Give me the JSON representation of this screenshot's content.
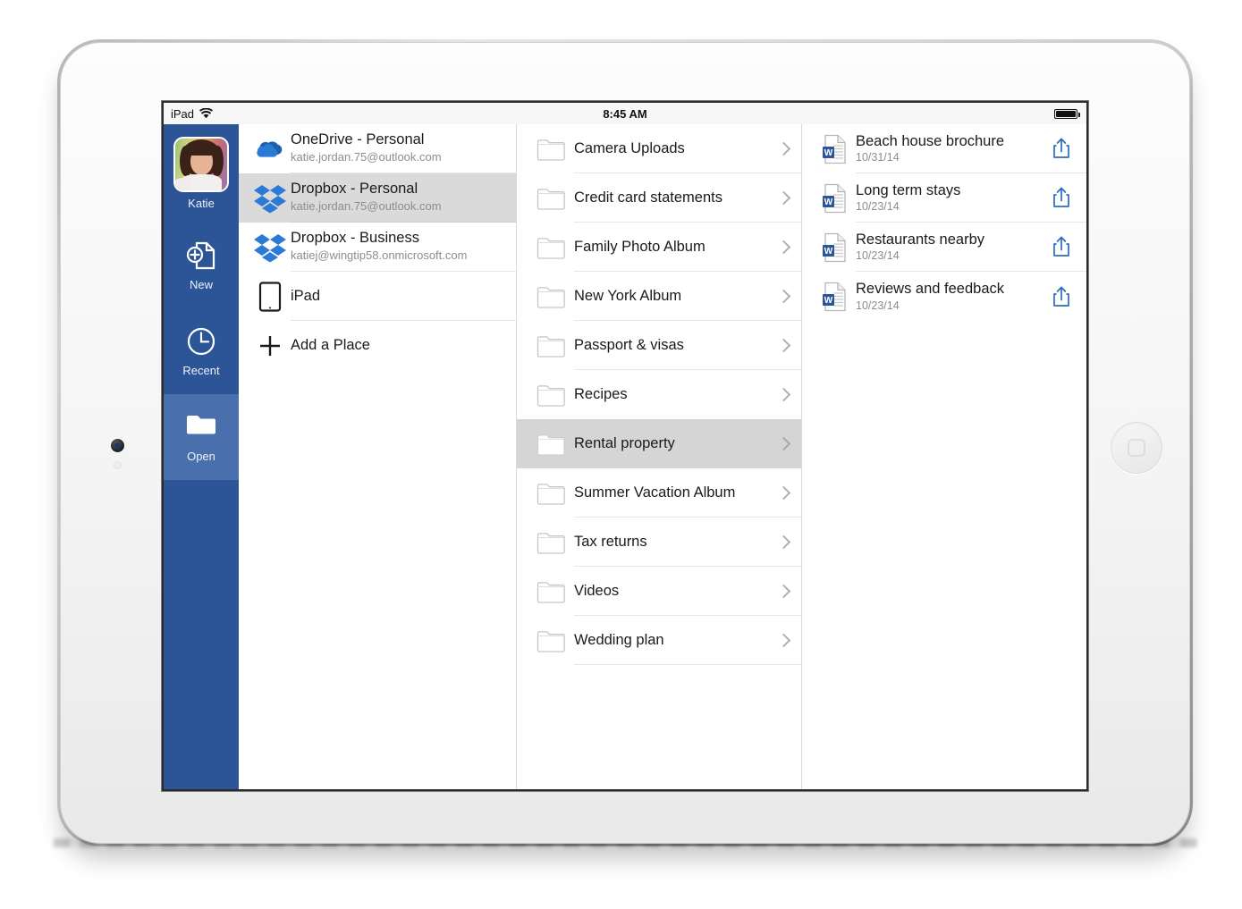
{
  "status_bar": {
    "carrier": "iPad",
    "wifi_icon": "wifi-icon",
    "time": "8:45 AM",
    "battery_icon": "battery-full-icon"
  },
  "sidebar": {
    "account_name": "Katie",
    "avatar_icon": "avatar",
    "items": [
      {
        "label": "New",
        "icon": "new-document-icon",
        "selected": false
      },
      {
        "label": "Recent",
        "icon": "clock-icon",
        "selected": false
      },
      {
        "label": "Open",
        "icon": "folder-open-icon",
        "selected": true
      }
    ]
  },
  "places": {
    "items": [
      {
        "title": "OneDrive - Personal",
        "subtitle": "katie.jordan.75@outlook.com",
        "icon": "onedrive-cloud-icon",
        "selected": false
      },
      {
        "title": "Dropbox - Personal",
        "subtitle": "katie.jordan.75@outlook.com",
        "icon": "dropbox-icon",
        "selected": true
      },
      {
        "title": "Dropbox - Business",
        "subtitle": "katiej@wingtip58.onmicrosoft.com",
        "icon": "dropbox-icon",
        "selected": false
      },
      {
        "title": "iPad",
        "subtitle": "",
        "icon": "ipad-device-icon",
        "selected": false
      },
      {
        "title": "Add a Place",
        "subtitle": "",
        "icon": "plus-icon",
        "selected": false
      }
    ]
  },
  "folders": {
    "items": [
      {
        "name": "Camera Uploads",
        "icon": "folder-icon",
        "selected": false
      },
      {
        "name": "Credit card statements",
        "icon": "folder-icon",
        "selected": false
      },
      {
        "name": "Family Photo Album",
        "icon": "folder-icon",
        "selected": false
      },
      {
        "name": "New York Album",
        "icon": "folder-icon",
        "selected": false
      },
      {
        "name": "Passport & visas",
        "icon": "folder-icon",
        "selected": false
      },
      {
        "name": "Recipes",
        "icon": "folder-icon",
        "selected": false
      },
      {
        "name": "Rental property",
        "icon": "folder-icon",
        "selected": true
      },
      {
        "name": "Summer Vacation Album",
        "icon": "folder-icon",
        "selected": false
      },
      {
        "name": "Tax returns",
        "icon": "folder-icon",
        "selected": false
      },
      {
        "name": "Videos",
        "icon": "folder-icon",
        "selected": false
      },
      {
        "name": "Wedding plan",
        "icon": "folder-icon",
        "selected": false
      }
    ]
  },
  "files": {
    "items": [
      {
        "name": "Beach house brochure",
        "date": "10/31/14",
        "icon": "word-document-icon",
        "action_icon": "share-icon"
      },
      {
        "name": "Long term stays",
        "date": "10/23/14",
        "icon": "word-document-icon",
        "action_icon": "share-icon"
      },
      {
        "name": "Restaurants nearby",
        "date": "10/23/14",
        "icon": "word-document-icon",
        "action_icon": "share-icon"
      },
      {
        "name": "Reviews and feedback",
        "date": "10/23/14",
        "icon": "word-document-icon",
        "action_icon": "share-icon"
      }
    ]
  },
  "colors": {
    "sidebar_blue": "#2b5597",
    "sidebar_selected_blue": "#4a6fad",
    "row_selected_gray": "#d5d5d5",
    "word_blue": "#2b579a",
    "dropbox_blue": "#1f7fe0",
    "share_blue": "#2b6cb9"
  }
}
